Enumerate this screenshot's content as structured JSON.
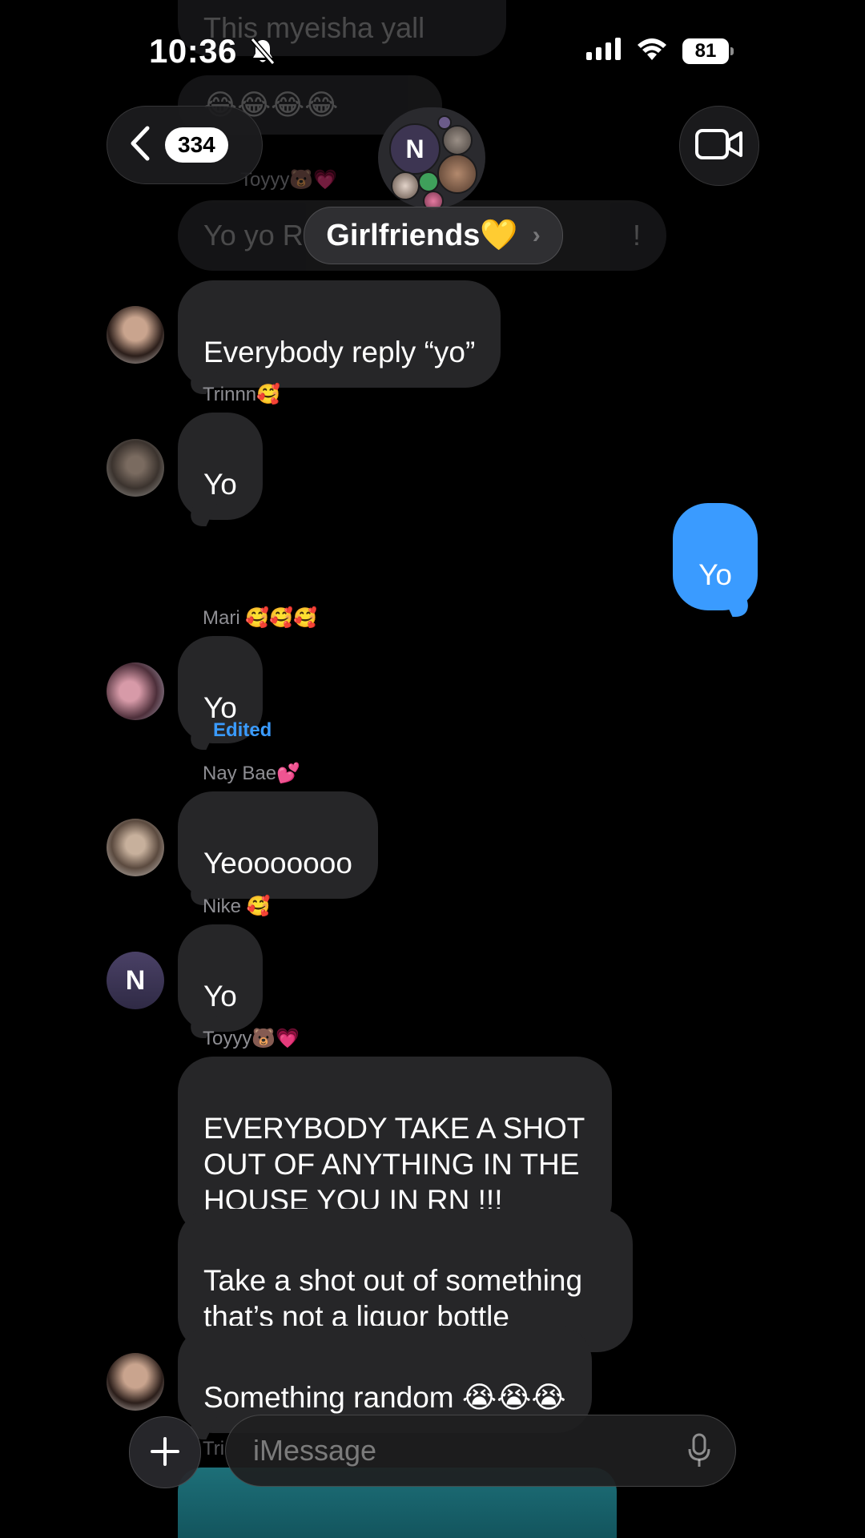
{
  "status_bar": {
    "time": "10:36",
    "battery": "81",
    "icons": [
      "mute-bell-icon",
      "cellular-signal-icon",
      "wifi-icon",
      "battery-icon"
    ]
  },
  "header": {
    "unread_count": "334",
    "group_title": "Girlfriends💛",
    "group_avatar_letter": "N",
    "video_icon": "video-camera-icon"
  },
  "background_messages": {
    "m1": "This myeisha yall",
    "m2": "😂😂😂😂",
    "m3_sender": "Toyyy🐻💗",
    "m4": "Yo yo R",
    "m4_end": "!"
  },
  "messages": {
    "m1": {
      "text": "Everybody reply “yo”"
    },
    "m2": {
      "sender": "Trinnn🥰",
      "text": "Yo"
    },
    "m3": {
      "text": "Yo"
    },
    "m4": {
      "sender": "Mari 🥰🥰🥰",
      "text": "Yo",
      "edited": "Edited"
    },
    "m5": {
      "sender": "Nay Bae💕",
      "text": "Yeooooooo"
    },
    "m6": {
      "sender": "Nike 🥰",
      "text": "Yo",
      "avatar_letter": "N"
    },
    "m7": {
      "sender": "Toyyy🐻💗",
      "text": "EVERYBODY TAKE A SHOT\nOUT OF ANYTHING IN THE\nHOUSE YOU IN RN !!!"
    },
    "m8": {
      "text": "Take a shot out of something\nthat’s not a liquor bottle"
    },
    "m9": {
      "text": "Something random 😭😭😭"
    },
    "m10": {
      "sender": "Tri"
    }
  },
  "composer": {
    "placeholder": "iMessage",
    "plus_icon": "plus-icon",
    "mic_icon": "microphone-icon"
  },
  "colors": {
    "background": "#000000",
    "incoming_bubble": "#262628",
    "outgoing_bubble": "#3a9bff",
    "sender_text": "#8e8e93"
  }
}
